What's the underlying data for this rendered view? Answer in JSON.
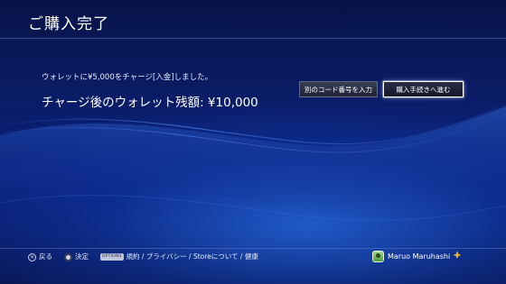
{
  "header": {
    "title": "ご購入完了"
  },
  "main": {
    "message": "ウォレットに¥5,000をチャージ[入金]しました。",
    "balance_label": "チャージ後のウォレット残額: ¥10,000"
  },
  "buttons": {
    "enter_other_code": "別のコード番号を入力",
    "proceed_to_checkout": "購入手続きへ進む"
  },
  "footer": {
    "back_label": "戻る",
    "back_symbol": "✕",
    "confirm_label": "決定",
    "options_badge": "OPTIONS",
    "links": "規約 / プライバシー / Storeについて / 健康"
  },
  "user": {
    "name": "Maruo Maruhashi",
    "plus_icon": "✚"
  },
  "colors": {
    "background_top": "#071348",
    "background_bottom": "#0a1d6e",
    "accent_wave": "#2a6de0",
    "plus_gold": "#f2c230"
  }
}
